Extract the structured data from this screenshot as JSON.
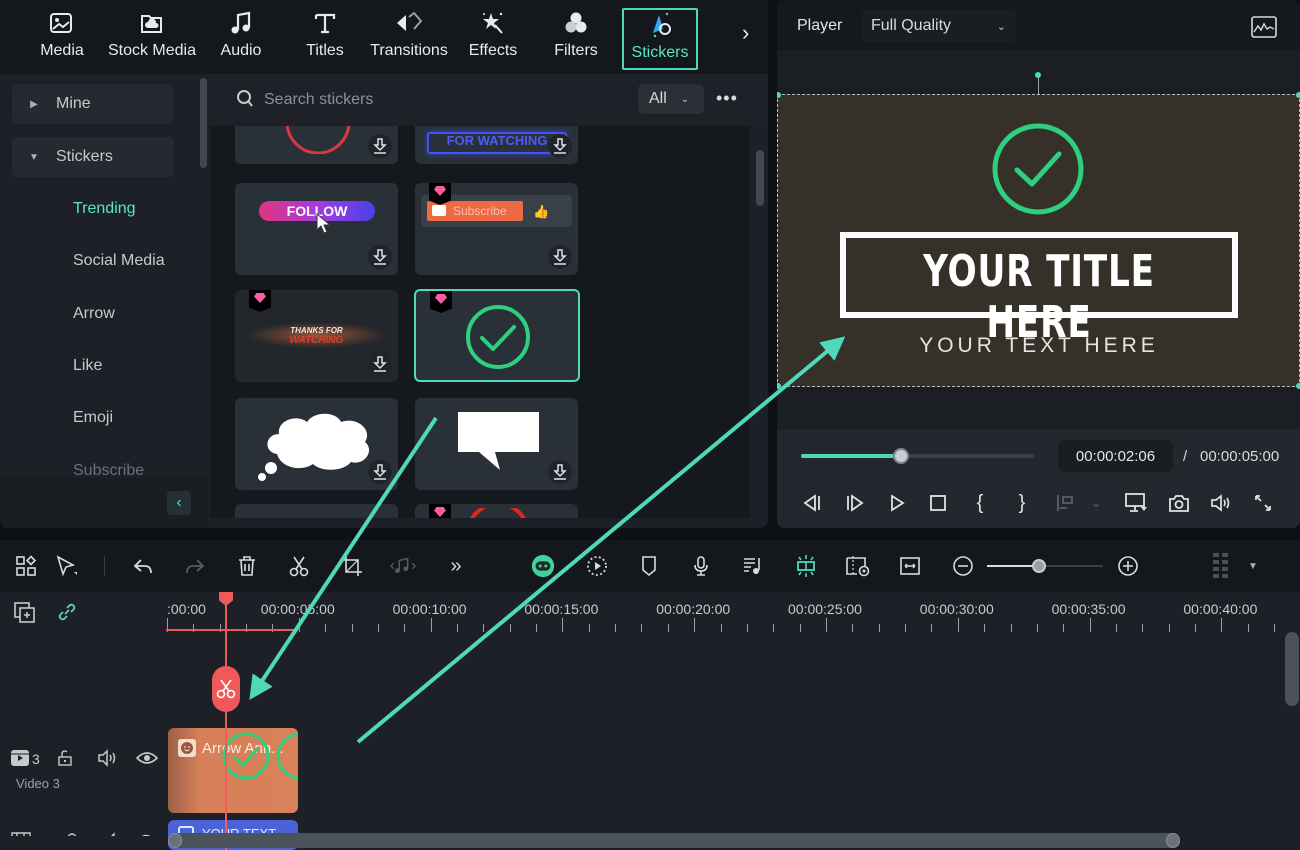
{
  "topnav": {
    "items": [
      {
        "label": "Media",
        "icon": "media-icon"
      },
      {
        "label": "Stock Media",
        "icon": "stock-media-icon"
      },
      {
        "label": "Audio",
        "icon": "audio-icon"
      },
      {
        "label": "Titles",
        "icon": "titles-icon"
      },
      {
        "label": "Transitions",
        "icon": "transitions-icon"
      },
      {
        "label": "Effects",
        "icon": "effects-icon"
      },
      {
        "label": "Filters",
        "icon": "filters-icon"
      },
      {
        "label": "Stickers",
        "icon": "stickers-icon",
        "active": true
      }
    ],
    "more": "›"
  },
  "sidebar": {
    "groups": [
      {
        "label": "Mine",
        "expanded": false
      },
      {
        "label": "Stickers",
        "expanded": true
      }
    ],
    "subitems": [
      {
        "label": "Trending",
        "active": true
      },
      {
        "label": "Social Media"
      },
      {
        "label": "Arrow"
      },
      {
        "label": "Like"
      },
      {
        "label": "Emoji"
      },
      {
        "label": "Subscribe"
      }
    ],
    "collapse": "‹"
  },
  "search": {
    "placeholder": "Search stickers",
    "filter": "All",
    "more": "•••"
  },
  "stickers": [
    {
      "name": "red-circle",
      "premium": false
    },
    {
      "name": "thanks-for-watching-neon",
      "premium": false,
      "text": "FOR WATCHING"
    },
    {
      "name": "follow-button",
      "premium": false,
      "text": "FOLLOW"
    },
    {
      "name": "subscribe-button",
      "premium": true,
      "text": "Subscribe"
    },
    {
      "name": "thanks-for-watching",
      "premium": true,
      "text": "THANKS FOR",
      "text2": "WATCHING"
    },
    {
      "name": "check-circle",
      "premium": true,
      "selected": true
    },
    {
      "name": "thought-cloud",
      "premium": false
    },
    {
      "name": "speech-bubble",
      "premium": false
    }
  ],
  "player": {
    "label": "Player",
    "quality": "Full Quality",
    "preview": {
      "title": "YOUR TITLE HERE",
      "subtitle": "YOUR TEXT HERE"
    },
    "progress": 0.43,
    "current_time": "00:00:02:06",
    "separator": "/",
    "total_time": "00:00:05:00"
  },
  "timeline": {
    "ruler_labels": [
      ":00:00",
      "00:00:05:00",
      "00:00:10:00",
      "00:00:15:00",
      "00:00:20:00",
      "00:00:25:00",
      "00:00:30:00",
      "00:00:35:00",
      "00:00:40:00"
    ],
    "zoom_level": 0.45,
    "track": {
      "number": "3",
      "name": "Video 3"
    },
    "clips": [
      {
        "label": "Arrow Ann...",
        "color": "#d98259"
      },
      {
        "label": "YOUR TEXT",
        "color": "#4a63d9"
      }
    ]
  },
  "colors": {
    "accent": "#4fd8b9",
    "playhead": "#f0595a",
    "premium": "#ff5aa5",
    "check_green": "#2ed07f"
  }
}
